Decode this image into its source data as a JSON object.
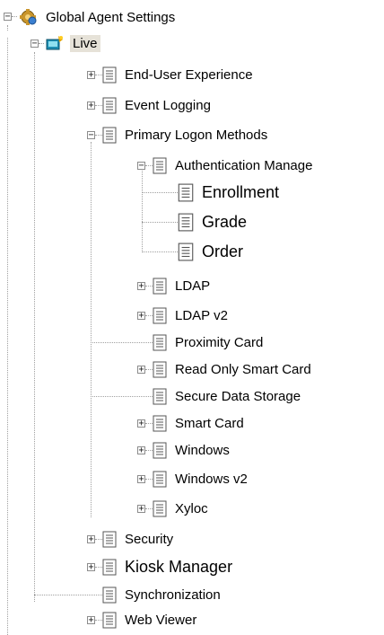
{
  "tree": {
    "root": {
      "label": "Global Agent Settings",
      "icon": "gear-globe-icon"
    },
    "live": {
      "label": "Live",
      "icon": "live-config-icon",
      "selected": true
    },
    "items": [
      {
        "label": "End-User Experience",
        "icon": "document-icon",
        "expander": "+"
      },
      {
        "label": "Event Logging",
        "icon": "document-icon",
        "expander": "+"
      },
      {
        "label": "Primary Logon Methods",
        "icon": "document-icon",
        "expander": "-"
      },
      {
        "label": "Authentication Manage",
        "icon": "document-icon",
        "expander": "-"
      },
      {
        "label": "Enrollment",
        "icon": "document-icon",
        "expander": ""
      },
      {
        "label": "Grade",
        "icon": "document-icon",
        "expander": ""
      },
      {
        "label": "Order",
        "icon": "document-icon",
        "expander": ""
      },
      {
        "label": "LDAP",
        "icon": "document-icon",
        "expander": "+"
      },
      {
        "label": "LDAP v2",
        "icon": "document-icon",
        "expander": "+"
      },
      {
        "label": "Proximity Card",
        "icon": "document-icon",
        "expander": ""
      },
      {
        "label": "Read Only Smart Card",
        "icon": "document-icon",
        "expander": "+"
      },
      {
        "label": "Secure Data Storage",
        "icon": "document-icon",
        "expander": ""
      },
      {
        "label": "Smart Card",
        "icon": "document-icon",
        "expander": "+"
      },
      {
        "label": "Windows",
        "icon": "document-icon",
        "expander": "+"
      },
      {
        "label": "Windows v2",
        "icon": "document-icon",
        "expander": "+"
      },
      {
        "label": "Xyloc",
        "icon": "document-icon",
        "expander": "+"
      },
      {
        "label": "Security",
        "icon": "document-icon",
        "expander": "+"
      },
      {
        "label": "Kiosk Manager",
        "icon": "document-icon",
        "expander": "+"
      },
      {
        "label": "Synchronization",
        "icon": "document-icon",
        "expander": ""
      },
      {
        "label": "Web Viewer",
        "icon": "document-icon",
        "expander": "+"
      }
    ]
  }
}
